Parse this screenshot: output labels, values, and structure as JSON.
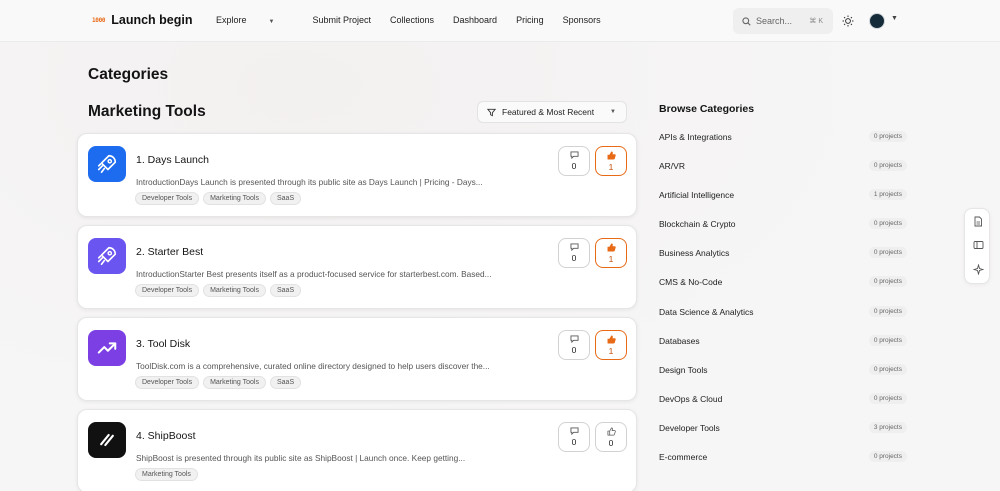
{
  "brand": {
    "mark": "1000",
    "name": "Launch begin"
  },
  "nav": {
    "items": [
      {
        "label": "Explore",
        "has_caret": true
      },
      {
        "label": "Submit Project"
      },
      {
        "label": "Collections"
      },
      {
        "label": "Dashboard"
      },
      {
        "label": "Pricing"
      },
      {
        "label": "Sponsors"
      }
    ]
  },
  "search": {
    "placeholder": "Search...",
    "shortcut": "⌘ K"
  },
  "page": {
    "title": "Categories",
    "section_title": "Marketing Tools"
  },
  "filter": {
    "label": "Featured & Most Recent"
  },
  "cards": [
    {
      "title": "1. Days Launch",
      "description": "IntroductionDays Launch is presented through its public site as Days Launch | Pricing - Days...",
      "tags": [
        "Developer Tools",
        "Marketing Tools",
        "SaaS"
      ],
      "comments": "0",
      "upvotes": "1",
      "upvoted": true,
      "icon": "rocket-icon",
      "icon_bg": "#1d6cf0"
    },
    {
      "title": "2. Starter Best",
      "description": "IntroductionStarter Best presents itself as a product-focused service for starterbest.com. Based...",
      "tags": [
        "Developer Tools",
        "Marketing Tools",
        "SaaS"
      ],
      "comments": "0",
      "upvotes": "1",
      "upvoted": true,
      "icon": "rocket-icon",
      "icon_bg": "#6a55f0"
    },
    {
      "title": "3. Tool Disk",
      "description": "ToolDisk.com is a comprehensive, curated online directory designed to help users discover the...",
      "tags": [
        "Developer Tools",
        "Marketing Tools",
        "SaaS"
      ],
      "comments": "0",
      "upvotes": "1",
      "upvoted": true,
      "icon": "trending-up-icon",
      "icon_bg": "#7b3fe4"
    },
    {
      "title": "4. ShipBoost",
      "description": "ShipBoost is presented through its public site as ShipBoost | Launch once. Keep getting...",
      "tags": [
        "Marketing Tools"
      ],
      "comments": "0",
      "upvotes": "0",
      "upvoted": false,
      "icon": "slash-lines-icon",
      "icon_bg": "#111111"
    }
  ],
  "browse": {
    "title": "Browse Categories",
    "categories": [
      {
        "name": "APIs & Integrations",
        "count": "0 projects"
      },
      {
        "name": "AR/VR",
        "count": "0 projects"
      },
      {
        "name": "Artificial Intelligence",
        "count": "1 projects"
      },
      {
        "name": "Blockchain & Crypto",
        "count": "0 projects"
      },
      {
        "name": "Business Analytics",
        "count": "0 projects"
      },
      {
        "name": "CMS & No-Code",
        "count": "0 projects"
      },
      {
        "name": "Data Science & Analytics",
        "count": "0 projects"
      },
      {
        "name": "Databases",
        "count": "0 projects"
      },
      {
        "name": "Design Tools",
        "count": "0 projects"
      },
      {
        "name": "DevOps & Cloud",
        "count": "0 projects"
      },
      {
        "name": "Developer Tools",
        "count": "3 projects"
      },
      {
        "name": "E-commerce",
        "count": "0 projects"
      }
    ]
  },
  "colors": {
    "accent": "#e86a17",
    "background": "#f7f6f6"
  }
}
